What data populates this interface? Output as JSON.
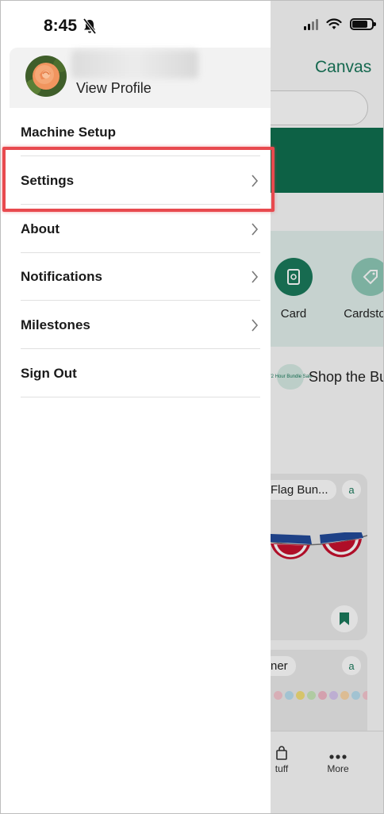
{
  "status_bar": {
    "time": "8:45",
    "bell_icon": "bell-slash-icon",
    "signal_icon": "cellular-signal-icon",
    "wifi_icon": "wifi-icon",
    "battery_icon": "battery-icon"
  },
  "profile": {
    "view_profile_label": "View Profile",
    "avatar_icon": "rose-avatar-icon"
  },
  "menu": {
    "items": [
      {
        "label": "Machine Setup",
        "has_chevron": false
      },
      {
        "label": "Settings",
        "has_chevron": true,
        "highlighted": true
      },
      {
        "label": "About",
        "has_chevron": true
      },
      {
        "label": "Notifications",
        "has_chevron": true
      },
      {
        "label": "Milestones",
        "has_chevron": true
      },
      {
        "label": "Sign Out",
        "has_chevron": false
      }
    ]
  },
  "background_app": {
    "brand": "Canvas",
    "categories": [
      {
        "label": "Card",
        "icon": "card-icon"
      },
      {
        "label": "Cardstock",
        "icon": "tag-icon"
      }
    ],
    "promo": {
      "badge": "72 Hour Bundle Sale",
      "text": "Shop the Bu"
    },
    "cards": [
      {
        "label": "Flag Bun..."
      },
      {
        "label": "ner"
      }
    ],
    "tabs": [
      {
        "label": "tuff",
        "icon": "bag-icon"
      },
      {
        "label": "More",
        "icon": "more-dots-icon"
      }
    ]
  },
  "colors": {
    "accent": "#1B7A5C",
    "highlight": "#E84A4F"
  }
}
